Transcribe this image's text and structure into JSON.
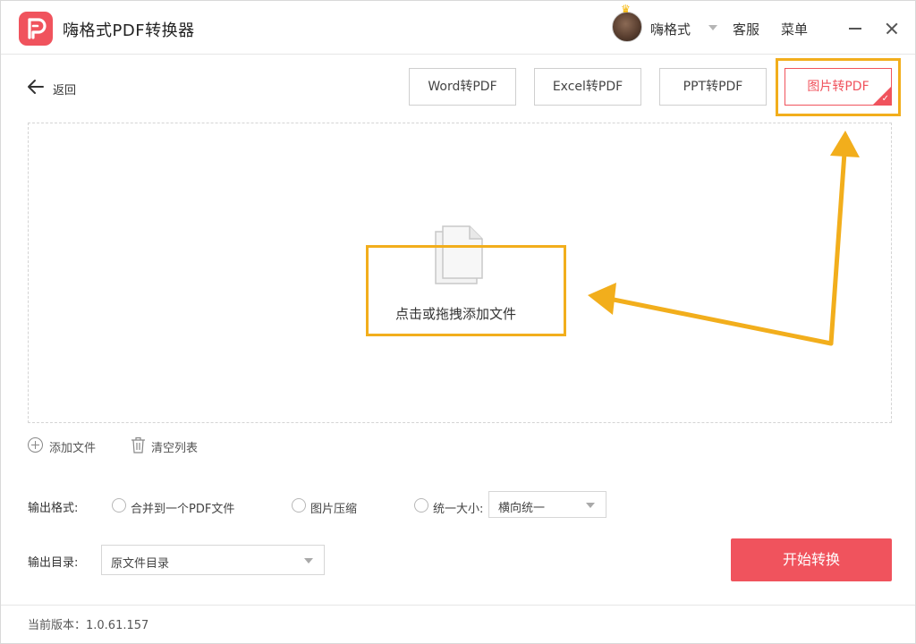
{
  "app": {
    "title": "嗨格式PDF转换器",
    "accent": "#f0535d",
    "highlight": "#f2ae1c"
  },
  "header": {
    "username": "嗨格式",
    "service_label": "客服",
    "menu_label": "菜单"
  },
  "nav": {
    "back_label": "返回"
  },
  "tabs": [
    {
      "label": "Word转PDF",
      "active": false
    },
    {
      "label": "Excel转PDF",
      "active": false
    },
    {
      "label": "PPT转PDF",
      "active": false
    },
    {
      "label": "图片转PDF",
      "active": true
    }
  ],
  "dropzone": {
    "label": "点击或拖拽添加文件"
  },
  "file_actions": {
    "add_label": "添加文件",
    "clear_label": "清空列表"
  },
  "output_format": {
    "label": "输出格式:",
    "options": [
      {
        "label": "合并到一个PDF文件",
        "checked": false
      },
      {
        "label": "图片压缩",
        "checked": false
      },
      {
        "label": "统一大小:",
        "checked": false
      }
    ],
    "size_select": "横向统一"
  },
  "output_dir": {
    "label": "输出目录:",
    "value": "原文件目录"
  },
  "start_button": "开始转换",
  "footer": {
    "version": "当前版本：1.0.61.157"
  }
}
